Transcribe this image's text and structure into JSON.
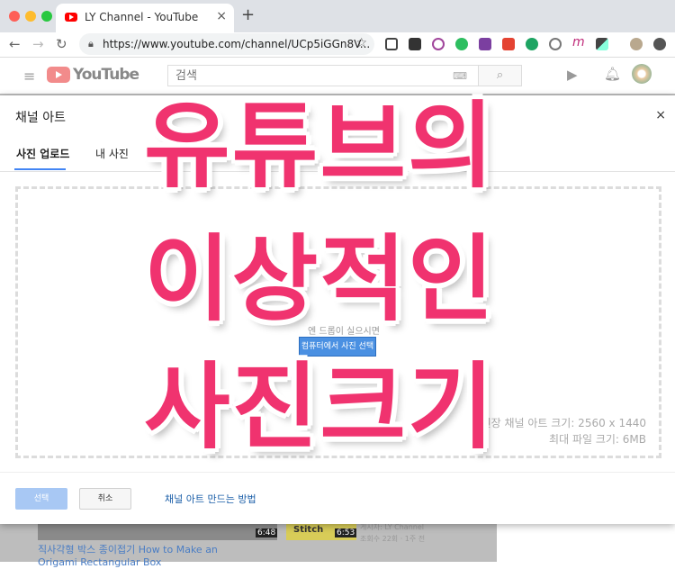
{
  "browser": {
    "tab_title": "LY Channel - YouTube",
    "tab_close": "×",
    "new_tab": "+",
    "url": "https://www.youtube.com/channel/UCp5iGGn8V...",
    "back": "←",
    "forward": "→",
    "reload": "↻",
    "star": "☆"
  },
  "youtube": {
    "wordmark": "YouTube",
    "search_placeholder": "검색",
    "hamburger": "≡"
  },
  "dialog": {
    "title": "채널 아트",
    "close": "×",
    "tabs": [
      {
        "label": "사진 업로드"
      },
      {
        "label": "내 사진"
      }
    ],
    "drop_hint": "엔 드롭이 실으시면",
    "pick_button": "컴퓨터에서 사진 선택",
    "recommended_size": "권장 채널 아트 크기: 2560 x 1440",
    "max_file_size": "최대 파일 크기: 6MB",
    "select_button": "선택",
    "cancel_button": "취소",
    "howto_link": "채널 아트 만드는 방법"
  },
  "background_page": {
    "video1_duration": "6:48",
    "video2_label": "Stitch",
    "video2_duration": "6:53",
    "meta_line1": "게시자: LY Channel",
    "meta_line2": "조회수 22회 · 1주 전",
    "video1_title": "직사각형 박스 종이접기 How to Make an Origami Rectangular Box"
  },
  "overlay_text": {
    "line1": "유튜브의",
    "line2": "이상적인",
    "line3": "사진크기"
  },
  "colors": {
    "overlay_pink": "#f0336f",
    "link_blue": "#1a5ea8",
    "primary_button": "#4a90e2"
  }
}
